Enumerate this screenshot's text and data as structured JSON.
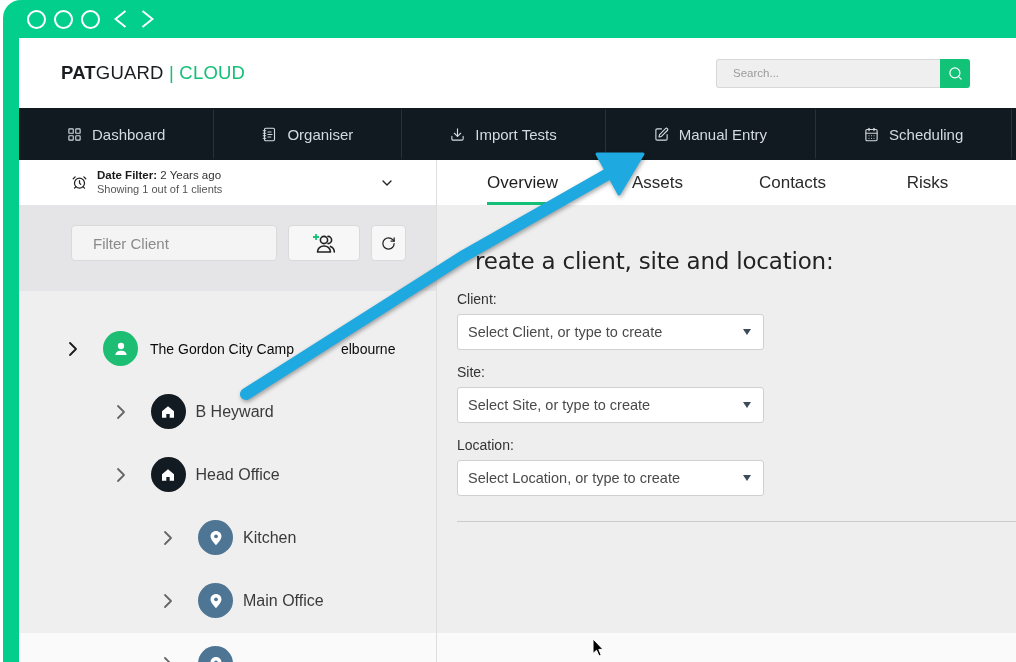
{
  "header": {
    "logo": {
      "wordmark": "**PAT**GUARD",
      "suffix": "| CLOUD"
    },
    "search": {
      "placeholder": "Search..."
    }
  },
  "nav": [
    {
      "label": "Dashboard",
      "selected": false
    },
    {
      "label": "Organiser",
      "selected": false
    },
    {
      "label": "Import Tests",
      "selected": false
    },
    {
      "label": "Manual Entry",
      "selected": false
    },
    {
      "label": "Scheduling",
      "selected": false
    }
  ],
  "date_filter": {
    "text": "**Date Filter:** 2 Years ago",
    "summary": "Showing 1 out of 1 clients"
  },
  "client_filter": {
    "placeholder": "Filter Client"
  },
  "tree": [
    {
      "kind": "client",
      "label_parts": [
        "The Gordon City Camp",
        "elbourne"
      ],
      "children": [
        {
          "kind": "site",
          "label": "B Heyward"
        },
        {
          "kind": "site",
          "label": "Head Office",
          "children": [
            {
              "kind": "location",
              "label": "Kitchen"
            },
            {
              "kind": "location",
              "label": "Main Office"
            },
            {
              "kind": "location"
            }
          ]
        }
      ]
    }
  ],
  "tabs": [
    {
      "label": "Overview",
      "selected": true
    },
    {
      "label": "Assets",
      "selected": false
    },
    {
      "label": "Contacts",
      "selected": false
    },
    {
      "label": "Risks",
      "selected": false
    }
  ],
  "form": {
    "heading": "reate a client, site and location:",
    "fields": [
      {
        "label": "Client:",
        "placeholder": "Select Client, or type to create"
      },
      {
        "label": "Site:",
        "placeholder": "Select Site, or type to create"
      },
      {
        "label": "Location:",
        "placeholder": "Select Location, or type to create"
      }
    ]
  }
}
